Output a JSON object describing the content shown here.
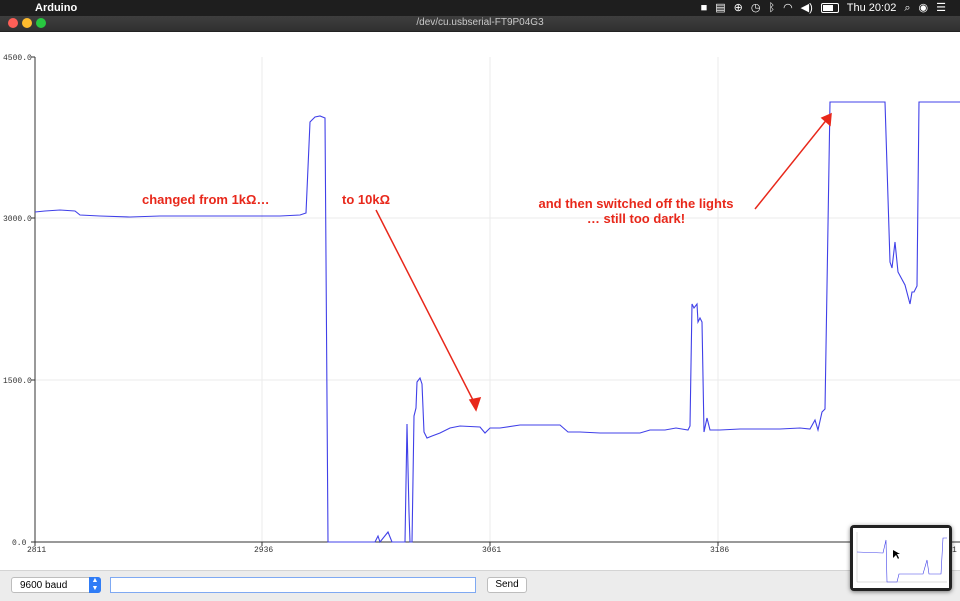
{
  "menubar": {
    "app_name": "Arduino",
    "clock": "Thu 20:02",
    "icons": [
      "apple-icon",
      "status-icon-1",
      "status-icon-2",
      "globe-icon",
      "clock-icon",
      "bluetooth-icon",
      "wifi-icon",
      "volume-icon",
      "battery-icon",
      "search-icon",
      "siri-icon",
      "control-center-icon"
    ]
  },
  "window": {
    "title": "/dev/cu.usbserial-FT9P04G3"
  },
  "plot": {
    "y_ticks": [
      "4500.0",
      "3000.0",
      "1500.0",
      "0.0"
    ],
    "x_ticks": [
      "2811",
      "2936",
      "3061",
      "3186",
      "1"
    ],
    "line_color": "#4040e8",
    "annotation_color": "#e8281b",
    "annotations": {
      "a1": "changed from 1kΩ…",
      "a2": "to 10kΩ",
      "a3_line1": "and then switched off the lights",
      "a3_line2": "… still too dark!"
    }
  },
  "toolbar": {
    "baud": "9600 baud",
    "input_value": "",
    "send_label": "Send"
  }
}
